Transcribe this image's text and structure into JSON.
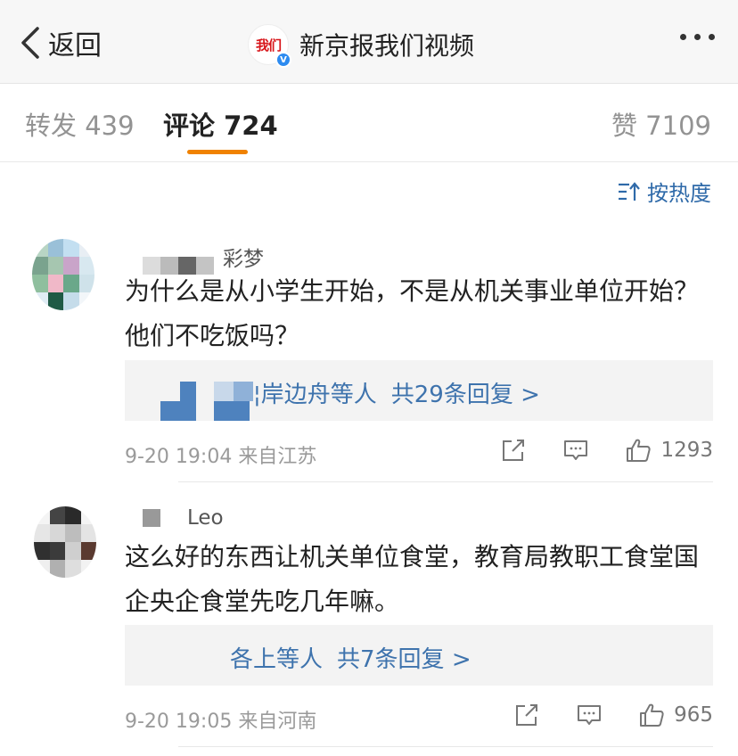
{
  "header": {
    "back_label": "返回",
    "logo_text": "我们",
    "verified_mark": "V",
    "title": "新京报我们视频",
    "more_icon": "more-dots-icon"
  },
  "tabs": [
    {
      "label": "转发 439",
      "active": false
    },
    {
      "label": "评论 724",
      "active": true
    },
    {
      "label": "赞 7109",
      "active": false
    }
  ],
  "sort": {
    "label": "按热度",
    "icon": "sort-icon"
  },
  "colors": {
    "accent": "#f08200",
    "link": "#3e73ad"
  },
  "comments": [
    {
      "username": "彩梦",
      "text": "为什么是从小学生开始，不是从机关事业单位开始？他们不吃饭吗？",
      "replies_names": "¦岸边舟等人",
      "replies_count": "共29条回复 >",
      "time_location": "9-20 19:04  来自江苏",
      "likes": "1293"
    },
    {
      "username": "Leo",
      "text": "这么好的东西让机关单位食堂，教育局教职工食堂国企央企食堂先吃几年嘛。",
      "replies_names": "各上等人",
      "replies_count": "共7条回复 >",
      "time_location": "9-20 19:05  来自河南",
      "likes": "965"
    }
  ]
}
